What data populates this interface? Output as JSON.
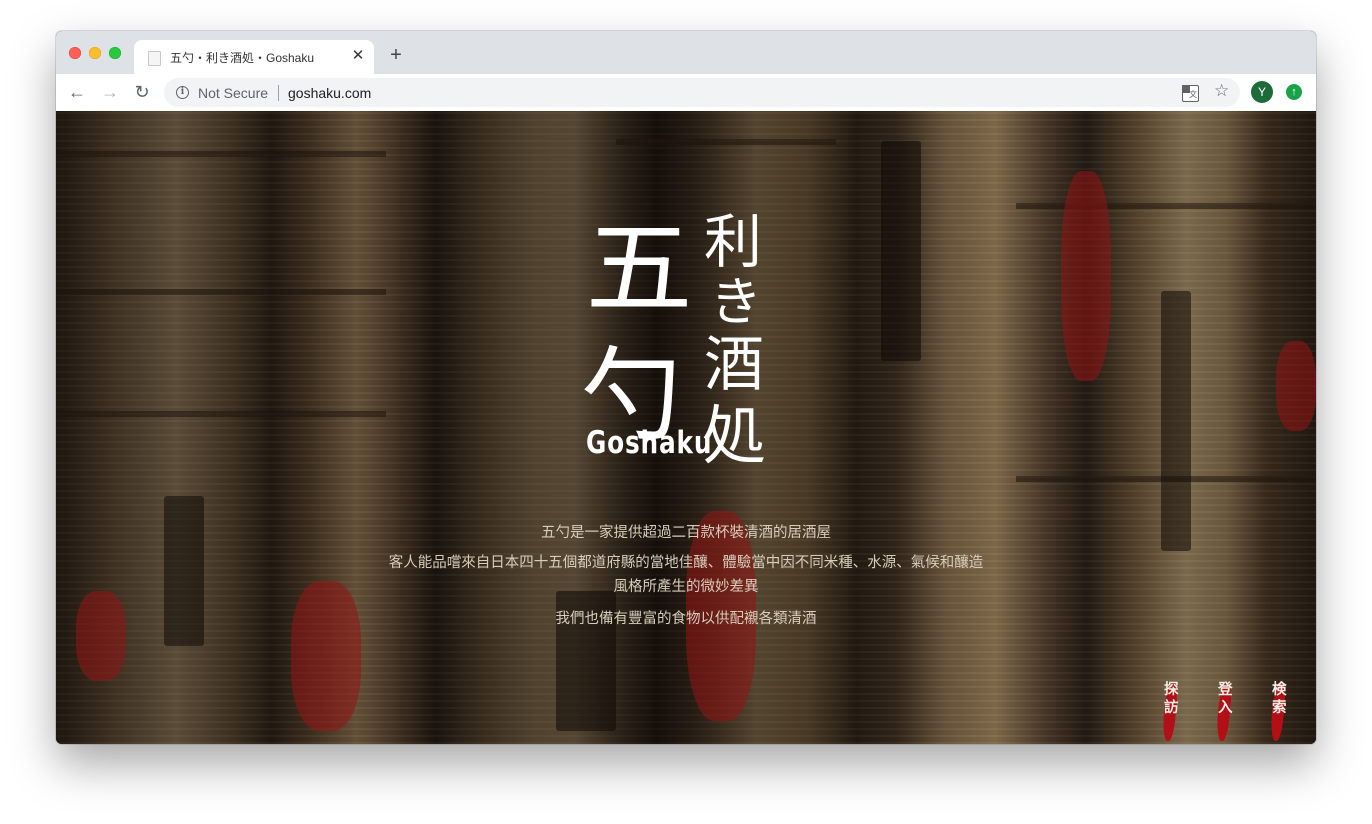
{
  "browser": {
    "tab_title": "五勺・利き酒処・Goshaku",
    "tab_close": "✕",
    "new_tab": "+",
    "security_label": "Not Secure",
    "url": "goshaku.com",
    "avatar_initial": "Y",
    "icons": {
      "back": "←",
      "forward": "→",
      "reload": "↻",
      "info": "i",
      "star": "☆",
      "extension": "↑"
    }
  },
  "page": {
    "logo": {
      "kanji_large_1": "五",
      "kanji_large_2": "勺",
      "kanji_small_1": "利",
      "kanji_small_2": "き",
      "kanji_small_3": "酒",
      "kanji_small_4": "処",
      "romaji": "Goshaku"
    },
    "description": [
      "五勺是一家提供超過二百款杯裝清酒的居酒屋",
      "客人能品嚐來自日本四十五個都道府縣的當地佳釀、體驗當中因不同米種、水源、氣候和釀造風格所產生的微妙差異",
      "我們也備有豐富的食物以供配襯各類清酒"
    ],
    "nav": [
      {
        "label": "探訪"
      },
      {
        "label": "登入"
      },
      {
        "label": "検索"
      }
    ]
  },
  "colors": {
    "brush_red": "#b30f16",
    "text_light": "#d8cdbb"
  }
}
